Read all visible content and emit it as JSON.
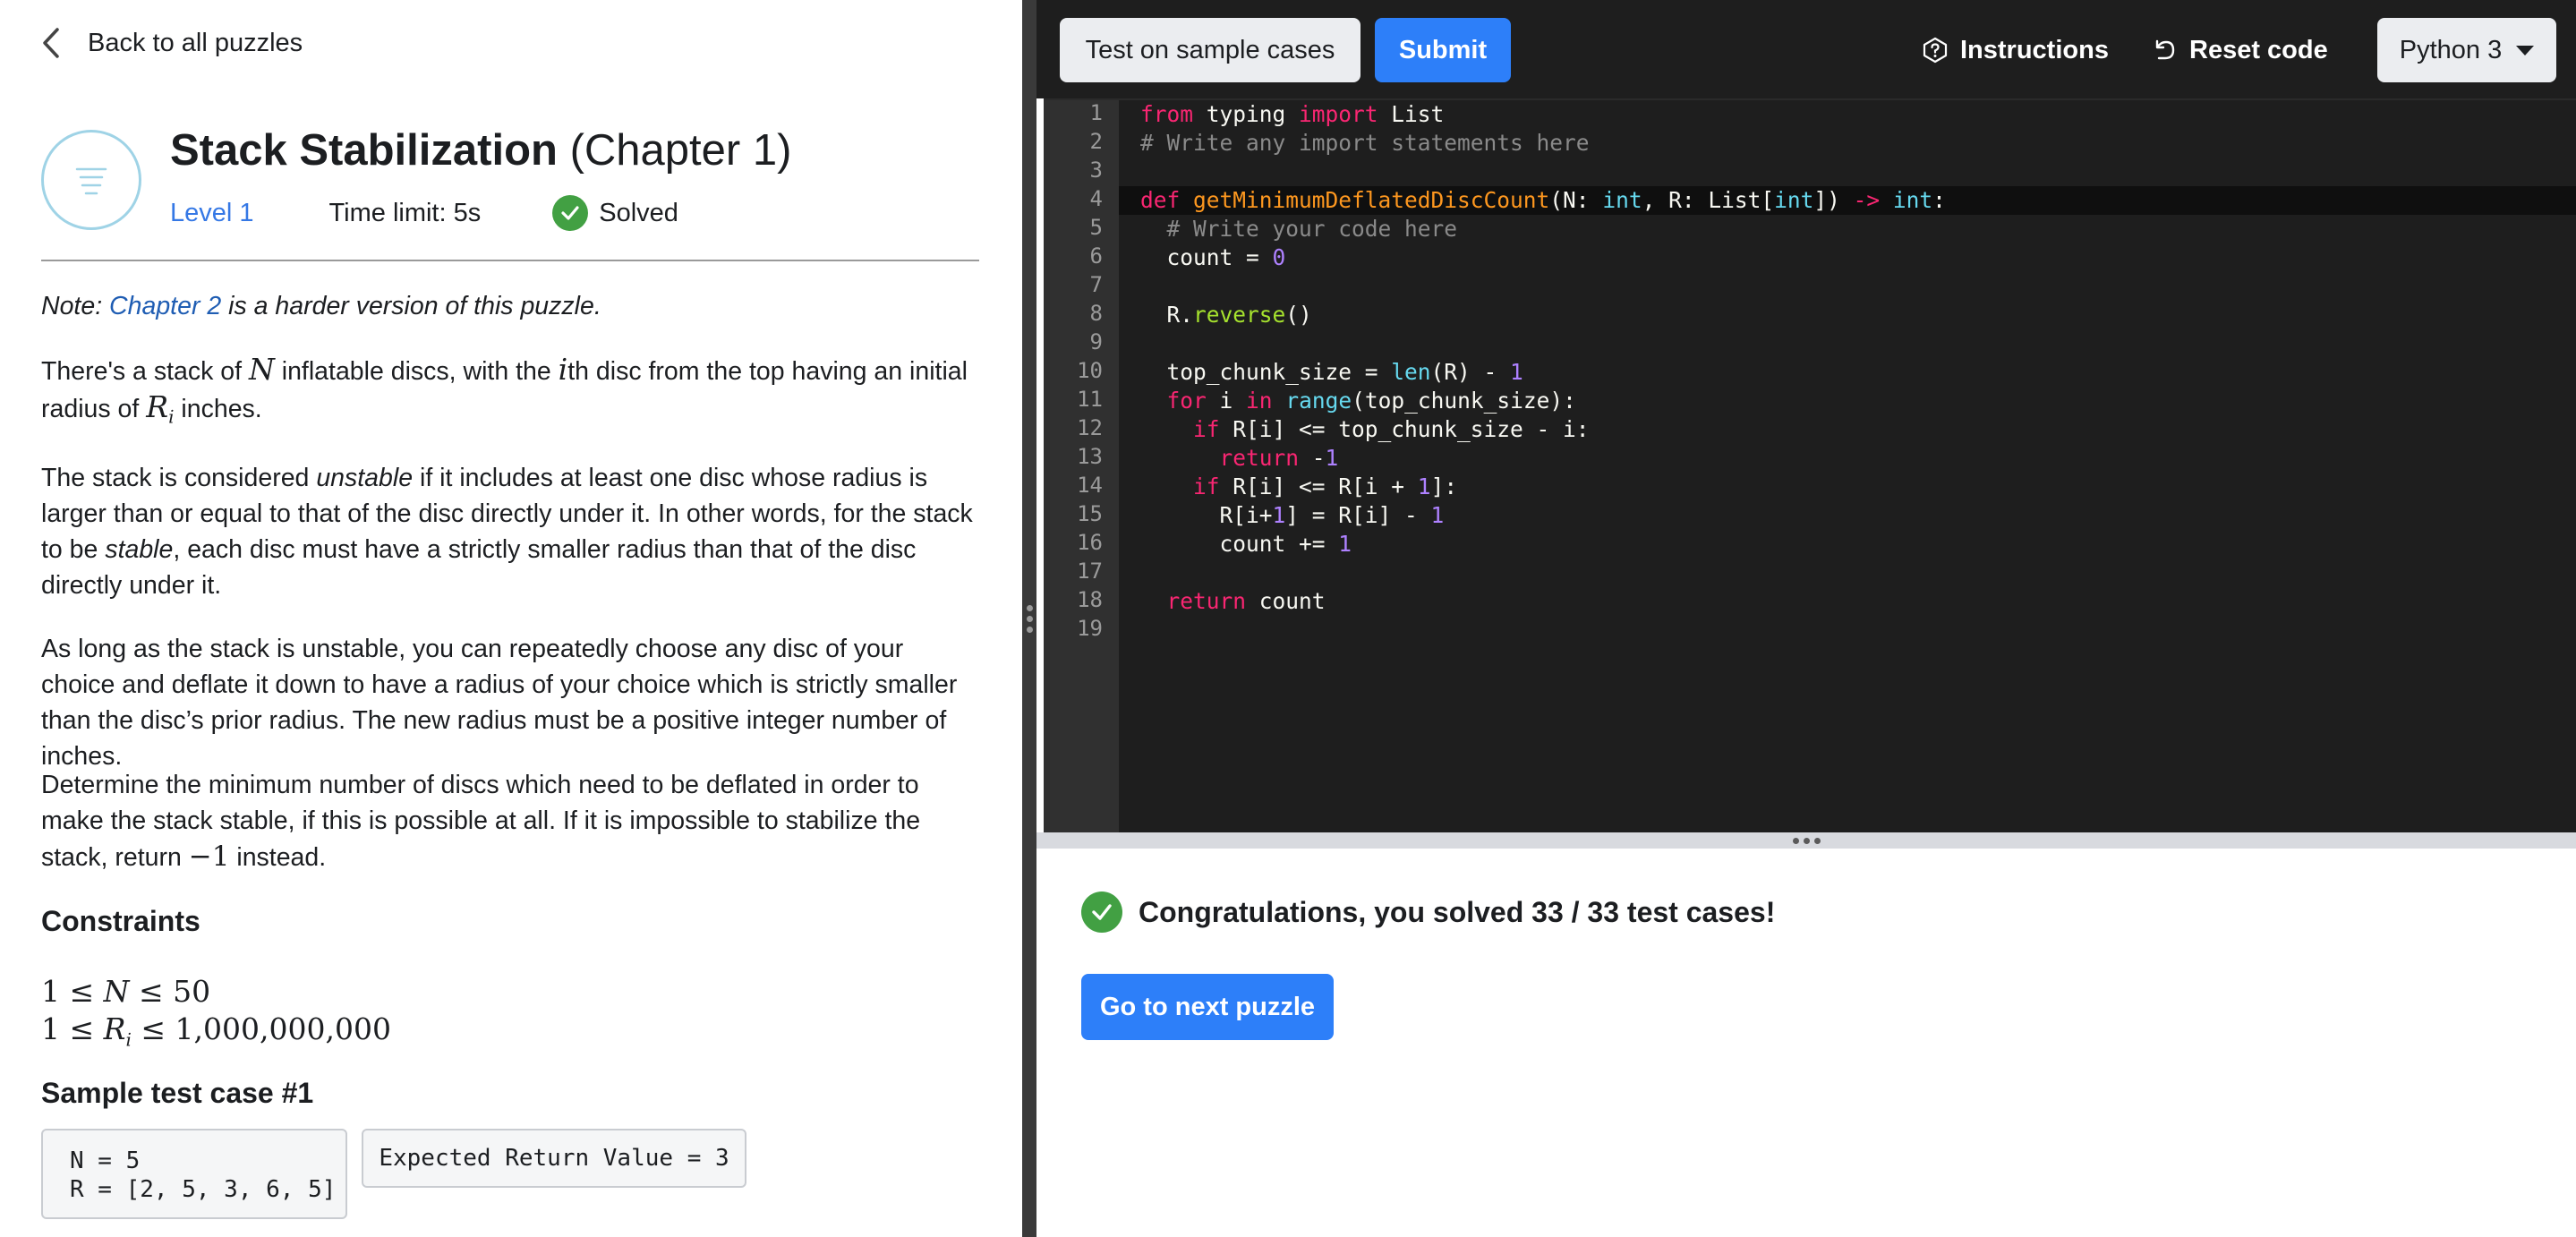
{
  "nav": {
    "back_label": "Back to all puzzles"
  },
  "puzzle": {
    "title": "Stack Stabilization",
    "chapter": "(Chapter 1)",
    "level": "Level 1",
    "time_limit": "Time limit: 5s",
    "status": "Solved"
  },
  "description": {
    "note_prefix": "Note: ",
    "note_link": "Chapter 2",
    "note_suffix": " is a harder version of this puzzle.",
    "p1_a": "There's a stack of ",
    "p1_N": "N",
    "p1_b": " inflatable discs, with the ",
    "p1_i": "i",
    "p1_c": "th disc from the top having an initial radius of ",
    "p1_R": "R",
    "p1_Ri": "i",
    "p1_d": " inches.",
    "p2_a": "The stack is considered ",
    "p2_em1": "unstable",
    "p2_b": " if it includes at least one disc whose radius is larger than or equal to that of the disc directly under it. In other words, for the stack to be ",
    "p2_em2": "stable",
    "p2_c": ", each disc must have a strictly smaller radius than that of the disc directly under it.",
    "p3": "As long as the stack is unstable, you can repeatedly choose any disc of your choice and deflate it down to have a radius of your choice which is strictly smaller than the disc’s prior radius. The new radius must be a positive integer number of inches.",
    "p4_a": "Determine the minimum number of discs which need to be deflated in order to make the stack stable, if this is possible at all. If it is impossible to stabilize the stack, return ",
    "p4_m": "−1",
    "p4_b": " instead."
  },
  "constraints": {
    "heading": "Constraints",
    "c1_a": "1 ≤ ",
    "c1_var": "N",
    "c1_b": " ≤ 50",
    "c2_a": "1 ≤ ",
    "c2_var": "R",
    "c2_sub": "i",
    "c2_b": " ≤ 1,000,000,000"
  },
  "sample": {
    "heading": "Sample test case #1",
    "input": "N = 5\nR = [2, 5, 3, 6, 5]",
    "output": "Expected Return Value = 3"
  },
  "toolbar": {
    "test_label": "Test on sample cases",
    "submit_label": "Submit",
    "instructions_label": "Instructions",
    "reset_label": "Reset code",
    "language": "Python 3"
  },
  "editor": {
    "line_numbers": [
      "1",
      "2",
      "3",
      "4",
      "5",
      "6",
      "7",
      "8",
      "9",
      "10",
      "11",
      "12",
      "13",
      "14",
      "15",
      "16",
      "17",
      "18",
      "19"
    ],
    "active_line": 4
  },
  "results": {
    "message": "Congratulations, you solved 33 / 33 test cases!",
    "next_label": "Go to next puzzle"
  },
  "colors": {
    "accent": "#2d7ff9",
    "success": "#42a043",
    "editor_bg": "#1e1e1e",
    "gutter_bg": "#303030"
  }
}
